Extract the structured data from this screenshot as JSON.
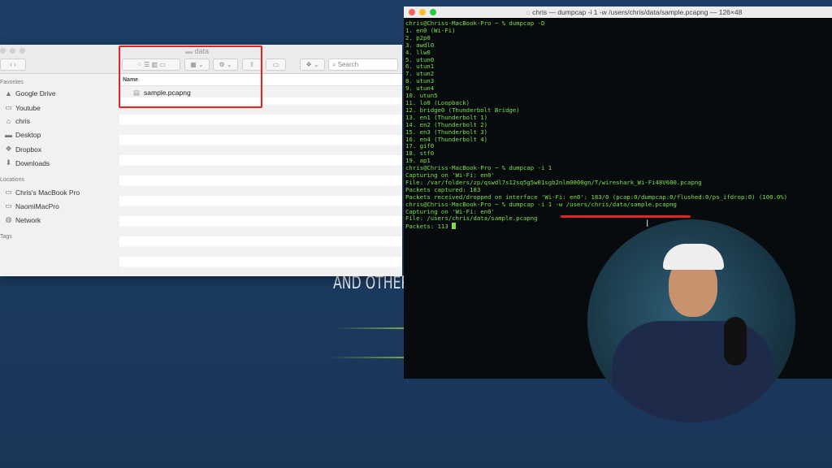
{
  "background": {
    "text": "AND OTHER"
  },
  "finder": {
    "title": "data",
    "search_placeholder": "Search",
    "sidebar": {
      "favorites_header": "Favorites",
      "favorites": [
        {
          "label": "Google Drive",
          "icon": "google-drive-icon"
        },
        {
          "label": "Youtube",
          "icon": "folder-icon"
        },
        {
          "label": "chris",
          "icon": "home-icon"
        },
        {
          "label": "Desktop",
          "icon": "desktop-icon"
        },
        {
          "label": "Dropbox",
          "icon": "dropbox-icon"
        },
        {
          "label": "Downloads",
          "icon": "downloads-icon"
        }
      ],
      "locations_header": "Locations",
      "locations": [
        {
          "label": "Chris's MacBook Pro",
          "icon": "laptop-icon"
        },
        {
          "label": "NaomiMacPro",
          "icon": "laptop-icon"
        },
        {
          "label": "Network",
          "icon": "network-icon"
        }
      ],
      "tags_header": "Tags"
    },
    "column_header": "Name",
    "files": [
      {
        "name": "sample.pcapng",
        "icon": "document-icon"
      }
    ]
  },
  "terminal": {
    "title": "chris — dumpcap -i 1 -w /users/chris/data/sample.pcapng — 126×48",
    "lines": [
      "chris@Chriss-MacBook-Pro ~ % dumpcap -D",
      "1. en0 (Wi-Fi)",
      "2. p2p0",
      "3. awdl0",
      "4. llw0",
      "5. utun0",
      "6. utun1",
      "7. utun2",
      "8. utun3",
      "9. utun4",
      "10. utun5",
      "11. lo0 (Loopback)",
      "12. bridge0 (Thunderbolt Bridge)",
      "13. en1 (Thunderbolt 1)",
      "14. en2 (Thunderbolt 2)",
      "15. en3 (Thunderbolt 3)",
      "16. en4 (Thunderbolt 4)",
      "17. gif0",
      "18. stf0",
      "19. ap1",
      "chris@Chriss-MacBook-Pro ~ % dumpcap -i 1",
      "Capturing on 'Wi-Fi: en0'",
      "File: /var/folders/zp/qswdl7s12sq5g5w01sgb2nlm0000gn/T/wireshark_Wi-Fi48V600.pcapng",
      "Packets captured: 183",
      "Packets received/dropped on interface 'Wi-Fi: en0': 183/0 (pcap:0/dumpcap:0/flushed:0/ps_ifdrop:0) (100.0%)",
      "chris@Chriss-MacBook-Pro ~ % dumpcap -i 1 -w /users/chris/data/sample.pcapng",
      "Capturing on 'Wi-Fi: en0'",
      "File: /users/chris/data/sample.pcapng",
      "Packets: 113 "
    ]
  },
  "colors": {
    "highlight": "#e8231f",
    "terminal_text": "#7fe04a",
    "background": "#1d3e66"
  }
}
